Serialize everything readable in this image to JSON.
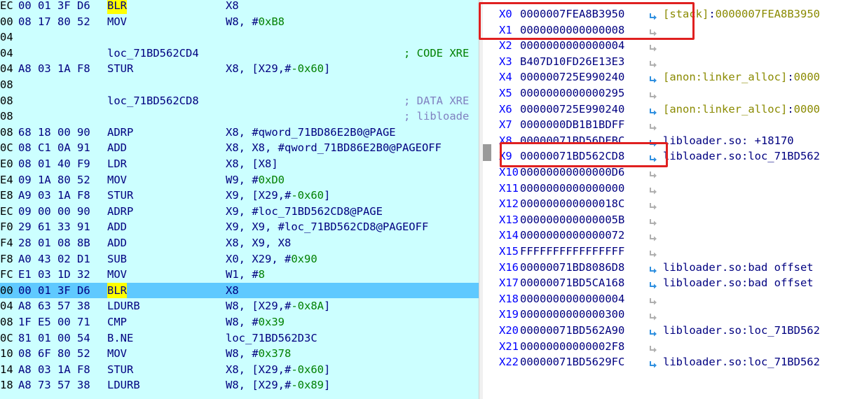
{
  "disassembly": [
    {
      "addr": "EC",
      "bytes": "00 01 3F D6",
      "label": "",
      "mnemonic": "BLR",
      "operands": [
        {
          "t": "X8",
          "k": "op"
        }
      ],
      "comment": "",
      "highlight": false,
      "blr": true
    },
    {
      "addr": "00",
      "bytes": "08 17 80 52",
      "label": "",
      "mnemonic": "MOV",
      "operands": [
        {
          "t": "W8, #",
          "k": "op"
        },
        {
          "t": "0xB8",
          "k": "num"
        }
      ],
      "comment": "",
      "highlight": false,
      "blr": false
    },
    {
      "addr": "04",
      "bytes": "",
      "label": "",
      "mnemonic": "",
      "operands": [],
      "comment": "",
      "highlight": false,
      "blr": false
    },
    {
      "addr": "04",
      "bytes": "",
      "label": "loc_71BD562CD4",
      "mnemonic": "",
      "operands": [],
      "comment": "; CODE XRE",
      "commentStyle": "cmt",
      "highlight": false,
      "blr": false
    },
    {
      "addr": "04",
      "bytes": "A8 03 1A F8",
      "label": "",
      "mnemonic": "STUR",
      "operands": [
        {
          "t": "X8, [X29,#",
          "k": "op"
        },
        {
          "t": "-0x60",
          "k": "num"
        },
        {
          "t": "]",
          "k": "op"
        }
      ],
      "comment": "",
      "highlight": false,
      "blr": false
    },
    {
      "addr": "08",
      "bytes": "",
      "label": "",
      "mnemonic": "",
      "operands": [],
      "comment": "",
      "highlight": false,
      "blr": false
    },
    {
      "addr": "08",
      "bytes": "",
      "label": "loc_71BD562CD8",
      "mnemonic": "",
      "operands": [],
      "comment": "; DATA XRE",
      "commentStyle": "cmt2",
      "highlight": false,
      "blr": false
    },
    {
      "addr": "08",
      "bytes": "",
      "label": "",
      "mnemonic": "",
      "operands": [],
      "comment": "; libloade",
      "commentStyle": "cmt2",
      "highlight": false,
      "blr": false
    },
    {
      "addr": "08",
      "bytes": "68 18 00 90",
      "label": "",
      "mnemonic": "ADRP",
      "operands": [
        {
          "t": "X8, #qword_71BD86E2B0@PAGE",
          "k": "op"
        }
      ],
      "comment": "",
      "highlight": false,
      "blr": false
    },
    {
      "addr": "0C",
      "bytes": "08 C1 0A 91",
      "label": "",
      "mnemonic": "ADD",
      "operands": [
        {
          "t": "X8, X8, #qword_71BD86E2B0@PAGEOFF",
          "k": "op"
        }
      ],
      "comment": "",
      "highlight": false,
      "blr": false
    },
    {
      "addr": "E0",
      "bytes": "08 01 40 F9",
      "label": "",
      "mnemonic": "LDR",
      "operands": [
        {
          "t": "X8, [X8]",
          "k": "op"
        }
      ],
      "comment": "",
      "highlight": false,
      "blr": false
    },
    {
      "addr": "E4",
      "bytes": "09 1A 80 52",
      "label": "",
      "mnemonic": "MOV",
      "operands": [
        {
          "t": "W9, #",
          "k": "op"
        },
        {
          "t": "0xD0",
          "k": "num"
        }
      ],
      "comment": "",
      "highlight": false,
      "blr": false
    },
    {
      "addr": "E8",
      "bytes": "A9 03 1A F8",
      "label": "",
      "mnemonic": "STUR",
      "operands": [
        {
          "t": "X9, [X29,#",
          "k": "op"
        },
        {
          "t": "-0x60",
          "k": "num"
        },
        {
          "t": "]",
          "k": "op"
        }
      ],
      "comment": "",
      "highlight": false,
      "blr": false
    },
    {
      "addr": "EC",
      "bytes": "09 00 00 90",
      "label": "",
      "mnemonic": "ADRP",
      "operands": [
        {
          "t": "X9, #loc_71BD562CD8@PAGE",
          "k": "op"
        }
      ],
      "comment": "",
      "highlight": false,
      "blr": false
    },
    {
      "addr": "F0",
      "bytes": "29 61 33 91",
      "label": "",
      "mnemonic": "ADD",
      "operands": [
        {
          "t": "X9, X9, #loc_71BD562CD8@PAGEOFF",
          "k": "op"
        }
      ],
      "comment": "",
      "highlight": false,
      "blr": false
    },
    {
      "addr": "F4",
      "bytes": "28 01 08 8B",
      "label": "",
      "mnemonic": "ADD",
      "operands": [
        {
          "t": "X8, X9, X8",
          "k": "op"
        }
      ],
      "comment": "",
      "highlight": false,
      "blr": false
    },
    {
      "addr": "F8",
      "bytes": "A0 43 02 D1",
      "label": "",
      "mnemonic": "SUB",
      "operands": [
        {
          "t": "X0, X29, #",
          "k": "op"
        },
        {
          "t": "0x90",
          "k": "num"
        }
      ],
      "comment": "",
      "highlight": false,
      "blr": false
    },
    {
      "addr": "FC",
      "bytes": "E1 03 1D 32",
      "label": "",
      "mnemonic": "MOV",
      "operands": [
        {
          "t": "W1, #",
          "k": "op"
        },
        {
          "t": "8",
          "k": "num"
        }
      ],
      "comment": "",
      "highlight": false,
      "blr": false
    },
    {
      "addr": "00",
      "bytes": "00 01 3F D6",
      "label": "",
      "mnemonic": "BLR",
      "operands": [
        {
          "t": "X8",
          "k": "op"
        }
      ],
      "comment": "",
      "highlight": true,
      "blr": true
    },
    {
      "addr": "04",
      "bytes": "A8 63 57 38",
      "label": "",
      "mnemonic": "LDURB",
      "operands": [
        {
          "t": "W8, [X29,#",
          "k": "op"
        },
        {
          "t": "-0x8A",
          "k": "num"
        },
        {
          "t": "]",
          "k": "op"
        }
      ],
      "comment": "",
      "highlight": false,
      "blr": false
    },
    {
      "addr": "08",
      "bytes": "1F E5 00 71",
      "label": "",
      "mnemonic": "CMP",
      "operands": [
        {
          "t": "W8, #",
          "k": "op"
        },
        {
          "t": "0x39",
          "k": "num"
        }
      ],
      "comment": "",
      "highlight": false,
      "blr": false
    },
    {
      "addr": "0C",
      "bytes": "81 01 00 54",
      "label": "",
      "mnemonic": "B.NE",
      "operands": [
        {
          "t": "loc_71BD562D3C",
          "k": "op"
        }
      ],
      "comment": "",
      "highlight": false,
      "blr": false
    },
    {
      "addr": "10",
      "bytes": "08 6F 80 52",
      "label": "",
      "mnemonic": "MOV",
      "operands": [
        {
          "t": "W8, #",
          "k": "op"
        },
        {
          "t": "0x378",
          "k": "num"
        }
      ],
      "comment": "",
      "highlight": false,
      "blr": false
    },
    {
      "addr": "14",
      "bytes": "A8 03 1A F8",
      "label": "",
      "mnemonic": "STUR",
      "operands": [
        {
          "t": "X8, [X29,#",
          "k": "op"
        },
        {
          "t": "-0x60",
          "k": "num"
        },
        {
          "t": "]",
          "k": "op"
        }
      ],
      "comment": "",
      "highlight": false,
      "blr": false
    },
    {
      "addr": "18",
      "bytes": "A8 73 57 38",
      "label": "",
      "mnemonic": "LDURB",
      "operands": [
        {
          "t": "W8, [X29,#",
          "k": "op"
        },
        {
          "t": "-0x89",
          "k": "num"
        },
        {
          "t": "]",
          "k": "op"
        }
      ],
      "comment": "",
      "highlight": false,
      "blr": false
    }
  ],
  "registers": [
    {
      "name": "X0",
      "value": "0000007FEA8B3950",
      "arrow": "blue",
      "desc": [
        {
          "t": "[stack]",
          "k": "olive"
        },
        {
          "t": ":",
          "k": "sep"
        },
        {
          "t": "0000007FEA8B3950",
          "k": "olive"
        }
      ]
    },
    {
      "name": "X1",
      "value": "0000000000000008",
      "arrow": "grey",
      "desc": []
    },
    {
      "name": "X2",
      "value": "0000000000000004",
      "arrow": "grey",
      "desc": []
    },
    {
      "name": "X3",
      "value": "B407D10FD26E13E3",
      "arrow": "grey",
      "desc": []
    },
    {
      "name": "X4",
      "value": "000000725E990240",
      "arrow": "blue",
      "desc": [
        {
          "t": "[anon:linker_alloc]",
          "k": "olive"
        },
        {
          "t": ":",
          "k": "sep"
        },
        {
          "t": "0000",
          "k": "olive"
        }
      ]
    },
    {
      "name": "X5",
      "value": "0000000000000295",
      "arrow": "grey",
      "desc": []
    },
    {
      "name": "X6",
      "value": "000000725E990240",
      "arrow": "blue",
      "desc": [
        {
          "t": "[anon:linker_alloc]",
          "k": "olive"
        },
        {
          "t": ":",
          "k": "sep"
        },
        {
          "t": "0000",
          "k": "olive"
        }
      ]
    },
    {
      "name": "X7",
      "value": "0000000DB1B1BDFF",
      "arrow": "grey",
      "desc": []
    },
    {
      "name": "X8",
      "value": "00000071BD56DEBC",
      "arrow": "blue",
      "desc": [
        {
          "t": "libloader.so: +18170",
          "k": "sep"
        }
      ]
    },
    {
      "name": "X9",
      "value": "00000071BD562CD8",
      "arrow": "blue",
      "desc": [
        {
          "t": "libloader.so:loc_71BD562",
          "k": "sep"
        }
      ]
    },
    {
      "name": "X10",
      "value": "00000000000000D6",
      "arrow": "grey",
      "desc": []
    },
    {
      "name": "X11",
      "value": "0000000000000000",
      "arrow": "grey",
      "desc": []
    },
    {
      "name": "X12",
      "value": "000000000000018C",
      "arrow": "grey",
      "desc": []
    },
    {
      "name": "X13",
      "value": "000000000000005B",
      "arrow": "grey",
      "desc": []
    },
    {
      "name": "X14",
      "value": "0000000000000072",
      "arrow": "grey",
      "desc": []
    },
    {
      "name": "X15",
      "value": "FFFFFFFFFFFFFFFF",
      "arrow": "grey",
      "desc": []
    },
    {
      "name": "X16",
      "value": "00000071BD8086D8",
      "arrow": "blue",
      "desc": [
        {
          "t": "libloader.so:bad offset",
          "k": "sep"
        }
      ]
    },
    {
      "name": "X17",
      "value": "00000071BD5CA168",
      "arrow": "blue",
      "desc": [
        {
          "t": "libloader.so:bad offset",
          "k": "sep"
        }
      ]
    },
    {
      "name": "X18",
      "value": "0000000000000004",
      "arrow": "grey",
      "desc": []
    },
    {
      "name": "X19",
      "value": "0000000000000300",
      "arrow": "grey",
      "desc": []
    },
    {
      "name": "X20",
      "value": "00000071BD562A90",
      "arrow": "blue",
      "desc": [
        {
          "t": "libloader.so:loc_71BD562",
          "k": "sep"
        }
      ]
    },
    {
      "name": "X21",
      "value": "00000000000002F8",
      "arrow": "grey",
      "desc": []
    },
    {
      "name": "X22",
      "value": "00000071BD5629FC",
      "arrow": "blue",
      "desc": [
        {
          "t": "libloader.so:loc_71BD562",
          "k": "sep"
        }
      ]
    }
  ],
  "icons": {
    "arrow": "jump-arrow-icon",
    "grip": "splitter-grip-icon"
  },
  "colors": {
    "disasm_bg": "#ccffff",
    "highlight_row": "#5fc9ff",
    "blr_highlight": "#ffff00",
    "annotation_box": "#e02020",
    "register_name": "#0000ff",
    "pointer_arrow": "#3090e0"
  }
}
